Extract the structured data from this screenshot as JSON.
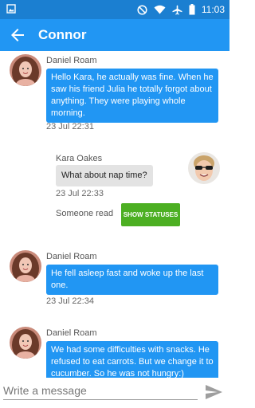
{
  "status_bar": {
    "time": "11:03",
    "icons": [
      "image-icon",
      "do-not-disturb-icon",
      "wifi-icon",
      "airplane-icon",
      "battery-icon"
    ]
  },
  "app_bar": {
    "title": "Connor",
    "back_icon": "arrow-back-icon",
    "background": "#2196f3"
  },
  "messages": [
    {
      "sender": "Daniel Roam",
      "direction": "incoming",
      "text": "Hello Kara, he actually was fine. When he saw his friend Julia he totally forgot about anything. They were playing whole morning.",
      "time": "23 Jul 22:31"
    },
    {
      "sender": "Kara Oakes",
      "direction": "outgoing",
      "text": "What about nap time?",
      "time": "23 Jul 22:33",
      "read_status": "Someone read",
      "status_button": "SHOW STATUSES"
    },
    {
      "sender": "Daniel Roam",
      "direction": "incoming",
      "text": "He fell asleep fast and woke up the last one.",
      "time": "23 Jul 22:34"
    },
    {
      "sender": "Daniel Roam",
      "direction": "incoming",
      "text": "We had some difficulties with snacks. He refused to eat carrots. But we change it to cucumber. So he was not hungry:)",
      "time": ""
    }
  ],
  "composer": {
    "placeholder": "Write a message",
    "send_icon": "send-icon"
  },
  "colors": {
    "incoming_bubble": "#2196f3",
    "outgoing_bubble": "#e3e3e3",
    "status_button": "#4caf22"
  }
}
